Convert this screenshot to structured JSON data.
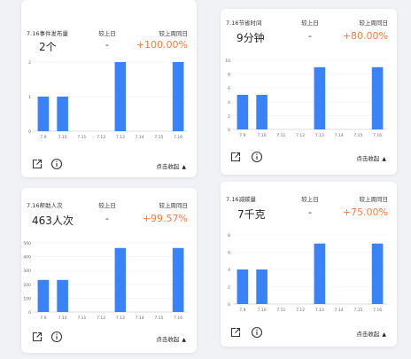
{
  "colors": {
    "accent": "#ff7a3d",
    "bar": "#3a82f7",
    "grid": "#ececec",
    "axis": "#666666"
  },
  "cards": [
    {
      "metric_title": "7.16事件发布量",
      "metric_value": "2个",
      "dod_label": "较上日",
      "dod_value": "-",
      "wow_label": "较上周同日",
      "wow_value": "+100.00%",
      "collapse_label": "点击收起"
    },
    {
      "metric_title": "7.16节省时间",
      "metric_value": "9分钟",
      "dod_label": "较上日",
      "dod_value": "-",
      "wow_label": "较上周同日",
      "wow_value": "+80.00%",
      "collapse_label": "点击收起"
    },
    {
      "metric_title": "7.16帮助人次",
      "metric_value": "463人次",
      "dod_label": "较上日",
      "dod_value": "-",
      "wow_label": "较上周同日",
      "wow_value": "+99.57%",
      "collapse_label": "点击收起"
    },
    {
      "metric_title": "7.16减碳量",
      "metric_value": "7千克",
      "dod_label": "较上日",
      "dod_value": "-",
      "wow_label": "较上周同日",
      "wow_value": "+75.00%",
      "collapse_label": "点击收起"
    }
  ],
  "chart_data": [
    {
      "type": "bar",
      "categories": [
        "7.9",
        "7.10",
        "7.11",
        "7.12",
        "7.13",
        "7.14",
        "7.15",
        "7.16"
      ],
      "values": [
        1,
        1,
        0,
        0,
        2,
        0,
        0,
        2
      ],
      "ylim": [
        0,
        2
      ],
      "yticks": [
        0,
        1,
        2
      ],
      "grid": true
    },
    {
      "type": "bar",
      "categories": [
        "7.9",
        "7.10",
        "7.11",
        "7.12",
        "7.13",
        "7.14",
        "7.15",
        "7.16"
      ],
      "values": [
        5,
        5,
        0,
        0,
        9,
        0,
        0,
        9
      ],
      "ylim": [
        0,
        10
      ],
      "yticks": [
        0,
        2,
        4,
        6,
        8,
        10
      ],
      "grid": true
    },
    {
      "type": "bar",
      "categories": [
        "7.9",
        "7.10",
        "7.11",
        "7.12",
        "7.13",
        "7.14",
        "7.15",
        "7.16"
      ],
      "values": [
        232,
        232,
        0,
        0,
        463,
        0,
        0,
        463
      ],
      "ylim": [
        0,
        500
      ],
      "yticks": [
        0,
        100,
        200,
        300,
        400,
        500
      ],
      "grid": true
    },
    {
      "type": "bar",
      "categories": [
        "7.9",
        "7.10",
        "7.11",
        "7.12",
        "7.13",
        "7.14",
        "7.15",
        "7.16"
      ],
      "values": [
        4,
        4,
        0,
        0,
        7,
        0,
        0,
        7
      ],
      "ylim": [
        0,
        8
      ],
      "yticks": [
        0,
        2,
        4,
        6,
        8
      ],
      "grid": true
    }
  ]
}
